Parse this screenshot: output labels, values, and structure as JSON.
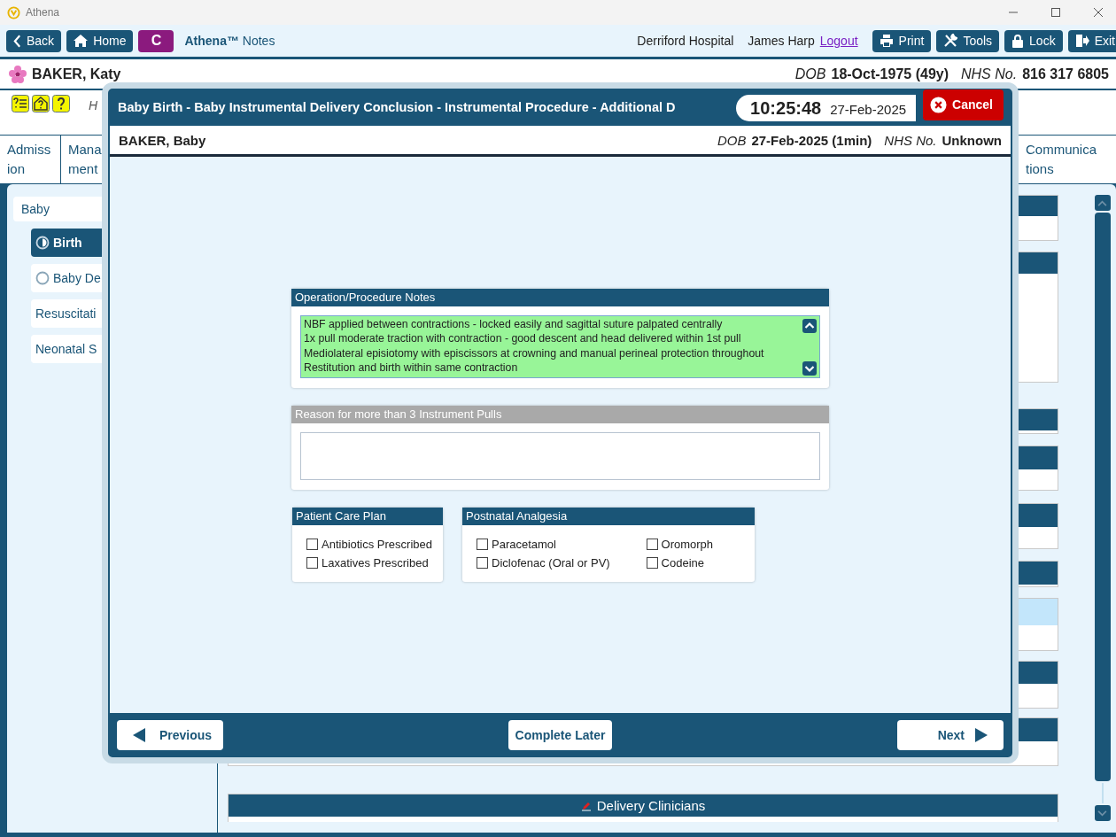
{
  "window": {
    "title": "Athena"
  },
  "toolbar": {
    "nav": [
      {
        "label": "Back"
      },
      {
        "label": "Home"
      }
    ],
    "module_badge": "C",
    "app_name": "Athena™",
    "app_section": "Notes",
    "hospital": "Derriford Hospital",
    "user": "James Harp",
    "logout": "Logout",
    "actions": [
      {
        "label": "Print"
      },
      {
        "label": "Tools"
      },
      {
        "label": "Lock"
      },
      {
        "label": "Exit"
      }
    ]
  },
  "patient": {
    "name": "BAKER, Katy",
    "dob_label": "DOB",
    "dob": "18-Oct-1975 (49y)",
    "nhs_label": "NHS No.",
    "nhs": "816 317 6805"
  },
  "alert_row": {
    "text": "H"
  },
  "tabs": [
    {
      "label": "Admiss\nion"
    },
    {
      "label": "Mana\nment"
    },
    {
      "label": "Communica\ntions"
    }
  ],
  "sidebar": {
    "items": [
      {
        "label": "Baby",
        "children": [
          {
            "label": "Birth",
            "selected": true,
            "kind": "partial"
          },
          {
            "label": "Baby De",
            "selected": false,
            "kind": "empty"
          },
          {
            "label": "Resuscitati",
            "selected": false,
            "kind": "plain"
          },
          {
            "label": "Neonatal S",
            "selected": false,
            "kind": "plain"
          }
        ]
      }
    ]
  },
  "main": {
    "delivery_clinicians": "Delivery Clinicians"
  },
  "dialog": {
    "title": "Baby Birth - Baby Instrumental Delivery Conclusion - Instrumental Procedure - Additional D",
    "time": "10:25:48",
    "date": "27-Feb-2025",
    "cancel": "Cancel",
    "baby": {
      "name": "BAKER, Baby",
      "dob_label": "DOB",
      "dob": "27-Feb-2025 (1min)",
      "nhs_label": "NHS No.",
      "nhs": "Unknown"
    },
    "notes": {
      "title": "Operation/Procedure Notes",
      "lines": [
        "NBF applied between contractions - locked easily and sagittal suture palpated centrally",
        "1x pull moderate traction with contraction - good descent and head delivered within 1st pull",
        "Mediolateral episiotomy with episcissors at crowning and manual perineal protection throughout",
        "Restitution and birth within same contraction"
      ]
    },
    "reason": {
      "title": "Reason for more than 3 Instrument Pulls",
      "disabled": true
    },
    "care_plan": {
      "title": "Patient Care Plan",
      "options": [
        {
          "label": "Antibiotics Prescribed",
          "checked": false
        },
        {
          "label": "Laxatives Prescribed",
          "checked": false
        }
      ]
    },
    "analgesia": {
      "title": "Postnatal Analgesia",
      "options": [
        {
          "label": "Paracetamol",
          "checked": false
        },
        {
          "label": "Oromorph",
          "checked": false
        },
        {
          "label": "Diclofenac (Oral or PV)",
          "checked": false
        },
        {
          "label": "Codeine",
          "checked": false
        }
      ]
    },
    "footer": {
      "previous": "Previous",
      "complete_later": "Complete Later",
      "next": "Next"
    }
  }
}
